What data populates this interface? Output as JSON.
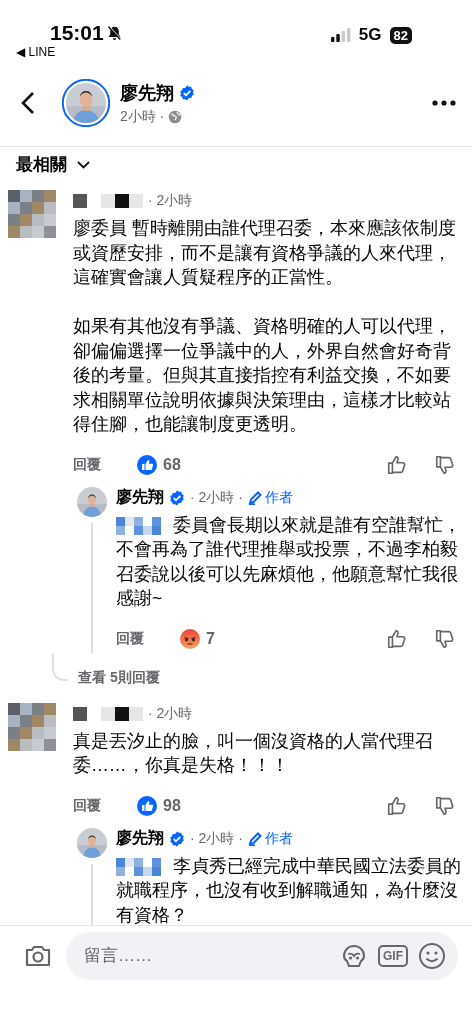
{
  "status_bar": {
    "time": "15:01",
    "back_app": "◀ LINE",
    "network": "5G",
    "battery": "82"
  },
  "post_header": {
    "author": "廖先翔",
    "verified": true,
    "time": "2小時 ·"
  },
  "sort": {
    "label": "最相關"
  },
  "comments": [
    {
      "kind": "comment",
      "time": "· 2小時",
      "paragraphs": [
        "廖委員 暫時離開由誰代理召委，本來應該依制度或資歷安排，而不是讓有資格爭議的人來代理，這確實會讓人質疑程序的正當性。",
        "如果有其他沒有爭議、資格明確的人可以代理，卻偏偏選擇一位爭議中的人，外界自然會好奇背後的考量。但與其直接指控有利益交換，不如要求相關單位說明依據與決策理由，這樣才比較站得住腳，也能讓制度更透明。"
      ],
      "reply_label": "回覆",
      "reaction": {
        "kind": "like",
        "count": "68"
      }
    },
    {
      "kind": "reply",
      "author": "廖先翔",
      "verified": true,
      "time": "· 2小時 ·",
      "badge": "作者",
      "paragraphs": [
        "委員會長期以來就是誰有空誰幫忙，不會再為了誰代理推舉或投票，不過李柏毅召委說以後可以先麻煩他，他願意幫忙我很感謝~"
      ],
      "reply_label": "回覆",
      "reaction": {
        "kind": "angry",
        "count": "7"
      },
      "more_replies": "查看 5則回覆"
    },
    {
      "kind": "comment",
      "time": "· 2小時",
      "paragraphs": [
        "真是丟汐止的臉，叫一個沒資格的人當代理召委……，你真是失格！！！"
      ],
      "reply_label": "回覆",
      "reaction": {
        "kind": "like",
        "count": "98"
      }
    },
    {
      "kind": "reply",
      "author": "廖先翔",
      "verified": true,
      "time": "· 2小時 ·",
      "badge": "作者",
      "paragraphs": [
        "李貞秀已經完成中華民國立法委員的就職程序，也沒有收到解職通知，為什麼沒有資格？"
      ]
    }
  ],
  "composer": {
    "placeholder": "留言……",
    "gif": "GIF"
  }
}
